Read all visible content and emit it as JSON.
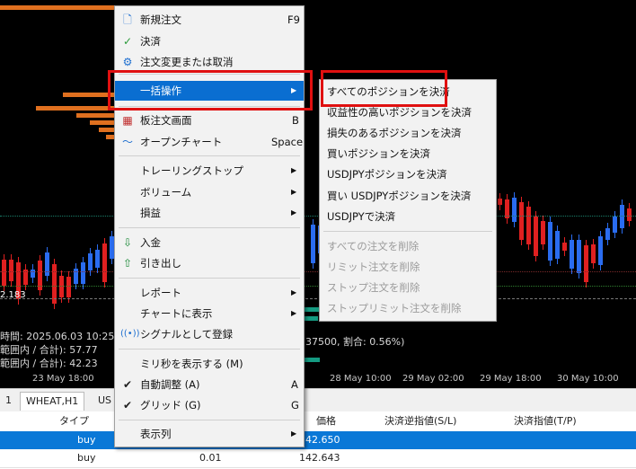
{
  "chart": {
    "x_labels": [
      "23 May 18:00",
      "28 May 10:00",
      "29 May 02:00",
      "29 May 18:00",
      "30 May 10:00"
    ],
    "info_line_1": "時間: 2025.06.03 10:25",
    "info_line_2": "範囲内 / 合計): 57.77",
    "info_line_3": "範囲内 / 合計): 42.23",
    "info_right": "37500, 割合: 0.56%)",
    "price_marker": "2.183"
  },
  "tabs": [
    {
      "label": "1"
    },
    {
      "label": "WHEAT,H1"
    },
    {
      "label": "US"
    }
  ],
  "table": {
    "headers": {
      "type": "タイプ",
      "price": "価格",
      "sl": "決済逆指値(S/L)",
      "tp": "決済指値(T/P)"
    },
    "rows": [
      {
        "type": "buy",
        "volume": "",
        "price": "42.650"
      },
      {
        "type": "buy",
        "volume": "0.01",
        "price": "142.643"
      }
    ]
  },
  "menu": {
    "new_order": {
      "label": "新規注文",
      "shortcut": "F9",
      "icon": "new-order-icon"
    },
    "close": {
      "label": "決済",
      "icon": "checkmark-icon"
    },
    "modify": {
      "label": "注文変更または取消",
      "icon": "gear-icon"
    },
    "bulk": {
      "label": "一括操作",
      "arrow": "▶"
    },
    "depth": {
      "label": "板注文画面",
      "shortcut": "B",
      "icon": "table-grid-icon"
    },
    "open_chart": {
      "label": "オープンチャート",
      "shortcut": "Space",
      "icon": "line-chart-icon"
    },
    "trailing": {
      "label": "トレーリングストップ",
      "arrow": "▶"
    },
    "volume": {
      "label": "ボリューム",
      "arrow": "▶"
    },
    "profit": {
      "label": "損益",
      "arrow": "▶"
    },
    "deposit": {
      "label": "入金",
      "icon": "deposit-icon"
    },
    "withdraw": {
      "label": "引き出し",
      "icon": "withdraw-icon"
    },
    "report": {
      "label": "レポート",
      "arrow": "▶"
    },
    "show_on_chart": {
      "label": "チャートに表示",
      "arrow": "▶"
    },
    "signal": {
      "label": "シグナルとして登録",
      "icon": "signal-icon"
    },
    "millis": {
      "label": "ミリ秒を表示する (M)"
    },
    "autoarrange": {
      "label": "自動調整 (A)",
      "shortcut": "A",
      "check": "✔"
    },
    "grid": {
      "label": "グリッド (G)",
      "shortcut": "G",
      "check": "✔"
    },
    "columns": {
      "label": "表示列",
      "arrow": "▶"
    }
  },
  "submenu": {
    "close_all": "すべてのポジションを決済",
    "close_profitable": "収益性の高いポジションを決済",
    "close_losing": "損失のあるポジションを決済",
    "close_buy": "買いポジションを決済",
    "close_usdjpy": "USDJPYポジションを決済",
    "close_buy_usdjpy": "買い USDJPYポジションを決済",
    "close_by_usdjpy": "USDJPYで決済",
    "delete_all_orders": "すべての注文を削除",
    "delete_limit": "リミット注文を削除",
    "delete_stop": "ストップ注文を削除",
    "delete_stoplimit": "ストップリミット注文を削除"
  },
  "colors": {
    "highlight": "#0a6ed1",
    "annotation": "#e01010",
    "bull": "#2a6cf0",
    "bear": "#e02020"
  }
}
